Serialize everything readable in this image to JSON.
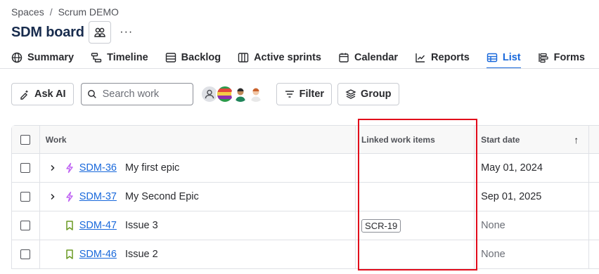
{
  "breadcrumb": {
    "root": "Spaces",
    "sep": "/",
    "current": "Scrum DEMO"
  },
  "board": {
    "title": "SDM board",
    "more": "···"
  },
  "tabs": [
    {
      "label": "Summary",
      "icon": "globe-icon"
    },
    {
      "label": "Timeline",
      "icon": "timeline-icon"
    },
    {
      "label": "Backlog",
      "icon": "backlog-icon"
    },
    {
      "label": "Active sprints",
      "icon": "columns-icon"
    },
    {
      "label": "Calendar",
      "icon": "calendar-icon"
    },
    {
      "label": "Reports",
      "icon": "chart-line-icon"
    },
    {
      "label": "List",
      "icon": "table-icon",
      "active": true
    },
    {
      "label": "Forms",
      "icon": "forms-icon"
    }
  ],
  "toolbar": {
    "ask_ai": "Ask AI",
    "search_placeholder": "Search work",
    "filter": "Filter",
    "group": "Group"
  },
  "table": {
    "columns": {
      "work": "Work",
      "linked": "Linked work items",
      "start": "Start date",
      "sort": "↑"
    },
    "rows": [
      {
        "expandable": true,
        "type": "epic",
        "key": "SDM-36",
        "summary": "My first epic",
        "linked": "",
        "start": "May 01, 2024"
      },
      {
        "expandable": true,
        "type": "epic",
        "key": "SDM-37",
        "summary": "My Second Epic",
        "linked": "",
        "start": "Sep 01, 2025"
      },
      {
        "expandable": false,
        "type": "story",
        "key": "SDM-47",
        "summary": "Issue 3",
        "linked": "SCR-19",
        "start": "None"
      },
      {
        "expandable": false,
        "type": "story",
        "key": "SDM-46",
        "summary": "Issue 2",
        "linked": "",
        "start": "None"
      }
    ]
  },
  "colors": {
    "accent": "#1868db",
    "epic": "#bf63f3",
    "story": "#6a9a23",
    "highlight": "#e20b1b"
  }
}
